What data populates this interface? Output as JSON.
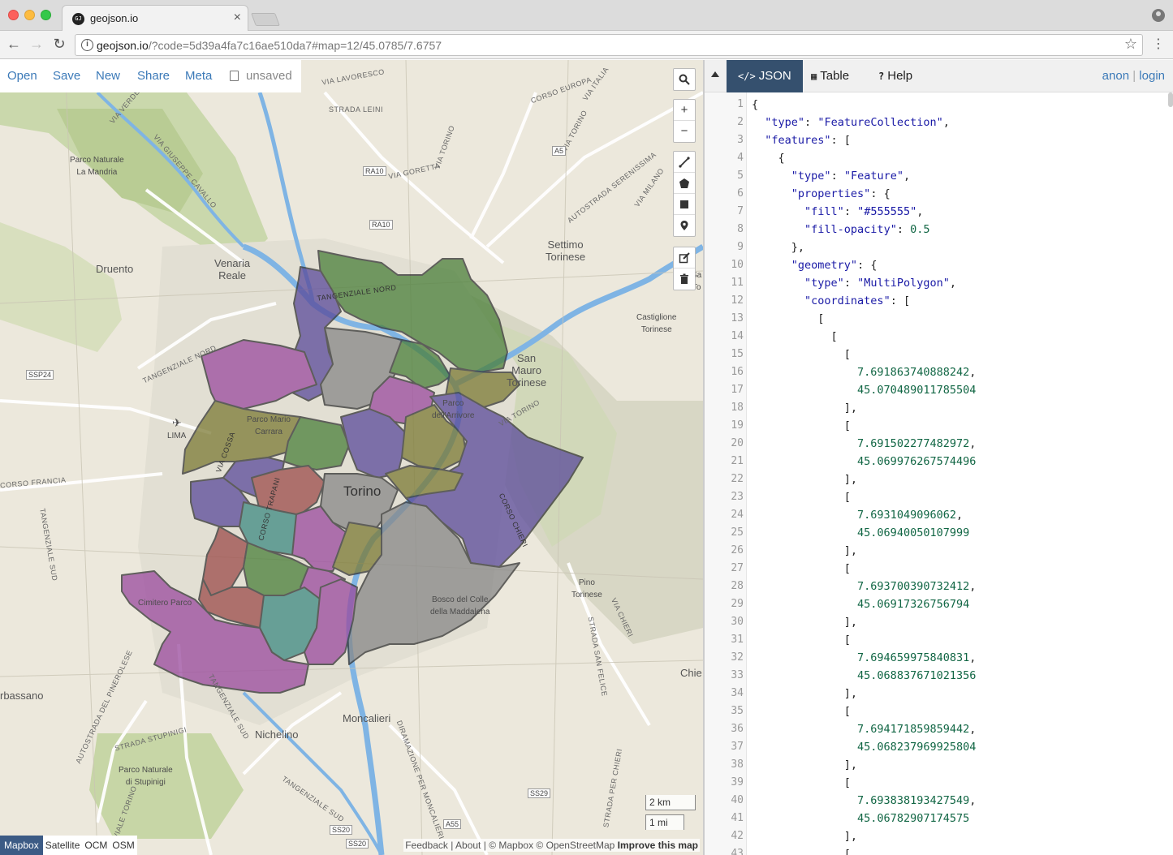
{
  "browser": {
    "tab_title": "geojson.io",
    "tab_close": "×",
    "url_host": "geojson.io",
    "url_rest": "/?code=5d39a4fa7c16ae510da7#map=12/45.0785/7.6757",
    "favicon_text": "GJ"
  },
  "top_menu": {
    "open": "Open",
    "save": "Save",
    "new": "New",
    "share": "Share",
    "meta": "Meta",
    "status": "unsaved"
  },
  "map_controls": {
    "search": "search-icon",
    "zoom_in": "+",
    "zoom_out": "−",
    "draw_tools": [
      "draw-line-icon",
      "draw-polygon-icon",
      "draw-rectangle-icon",
      "draw-marker-icon"
    ],
    "edit_tools": [
      "edit-icon",
      "trash-icon"
    ]
  },
  "map_labels": {
    "torino": "Torino",
    "venaria": "Venaria\nReale",
    "druento": "Druento",
    "settimo": "Settimo\nTorinese",
    "san_mauro": "San\nMauro\nTorinese",
    "castiglione": "Castiglione\nTorinese",
    "pino": "Pino\nTorinese",
    "chieri": "Chie",
    "moncalieri": "Moncalieri",
    "nichelino": "Nichelino",
    "orbassano": "rbassano",
    "parco_mandria": "Parco Naturale\nLa Mandria",
    "parco_stupinigi": "Parco Naturale\ndi Stupinigi",
    "parco_ruffini": "Parco Mario\nCarrara",
    "parco_arrivore": "Parco\ndell'Arrivore",
    "bosco_maddalena": "Bosco del Colle\ndella Maddalena",
    "cimitero_parco": "Cimitero Parco",
    "lima": "LIMA",
    "via_lavoresco": "VIA LAVORESCO",
    "strada_leini": "STRADA LEINI",
    "via_goretta": "VIA GORETTA",
    "corso_europa": "CORSO EUROPA",
    "via_italia": "VIA ITALIA",
    "via_torino": "VIA TORINO",
    "via_milano": "VIA MILANO",
    "autostrada_serenissima": "AUTOSTRADA SERENISSIMA",
    "tangenziale_nord": "TANGENZIALE NORD",
    "tangenziale_nord2": "TANGENZIALE NORD",
    "via_cavallo": "VIA GIUSEPPE CAVALLO",
    "via_verde": "VIA VERDE",
    "corso_francia": "CORSO FRANCIA",
    "tangenziale_sud": "TANGENZIALE SUD",
    "tangenziale_sud2": "TANGENZIALE SUD",
    "tangenziale_sud3": "TANGENZIALE SUD",
    "via_cossa": "VIA COSSA",
    "corso_trapani": "CORSO TRAPANI",
    "corso_chieri": "CORSO CHIERI",
    "via_chieri": "VIA CHIERI",
    "strada_felice": "STRADA SAN FELICE",
    "strada_per_chieri": "STRADA PER CHIERI",
    "strada_stupinigi": "STRADA STUPINIGI",
    "autostrada_pinerolese": "AUTOSTRADA DEL PINEROLESE",
    "viale_torino": "VIALE TORINO",
    "diramazione": "DIRAMAZIONE PER MONCALIERI",
    "via_torino2": "VIA TORINO",
    "badge_ra10a": "RA10",
    "badge_ra10b": "RA10",
    "badge_a5": "A5",
    "badge_ssp24": "SSP24",
    "badge_ss29": "SS29",
    "badge_ss20a": "SS20",
    "badge_ss20b": "SS20",
    "badge_a55": "A55",
    "sa_partial": "Sa\nTo"
  },
  "scale": {
    "km": "2 km",
    "mi": "1 mi"
  },
  "layers": [
    "Mapbox",
    "Satellite",
    "OCM",
    "OSM"
  ],
  "active_layer": "Mapbox",
  "attribution": {
    "feedback": "Feedback",
    "about": "About",
    "copyright": "© Mapbox © OpenStreetMap",
    "improve": "Improve this map",
    "sep": "|"
  },
  "right_tabs": {
    "json": "JSON",
    "table": "Table",
    "help": "Help"
  },
  "auth": {
    "anon": "anon",
    "sep": "|",
    "login": "login"
  },
  "code_lines": [
    "{",
    "  \"type\": \"FeatureCollection\",",
    "  \"features\": [",
    "    {",
    "      \"type\": \"Feature\",",
    "      \"properties\": {",
    "        \"fill\": \"#555555\",",
    "        \"fill-opacity\": 0.5",
    "      },",
    "      \"geometry\": {",
    "        \"type\": \"MultiPolygon\",",
    "        \"coordinates\": [",
    "          [",
    "            [",
    "              [",
    "                7.691863740888242,",
    "                45.070489011785504",
    "              ],",
    "              [",
    "                7.691502277482972,",
    "                45.069976267574496",
    "              ],",
    "              [",
    "                7.6931049096062,",
    "                45.06940050107999",
    "              ],",
    "              [",
    "                7.693700390732412,",
    "                45.06917326756794",
    "              ],",
    "              [",
    "                7.694659975840831,",
    "                45.068837671021356",
    "              ],",
    "              [",
    "                7.694171859859442,",
    "                45.068237969925804",
    "              ],",
    "              [",
    "                7.693838193427549,",
    "                45.06782907174575",
    "              ],",
    "              ["
  ],
  "colors": {
    "accent_link": "#3c7ab8",
    "active_tab": "#35506e",
    "json_key": "#1a1aa6",
    "json_number": "#116644",
    "district_colors": [
      "#4b7f3a",
      "#5a4a9a",
      "#9a4a9e",
      "#888888",
      "#7c7a35",
      "#3f8a82",
      "#9c4c4a"
    ]
  }
}
